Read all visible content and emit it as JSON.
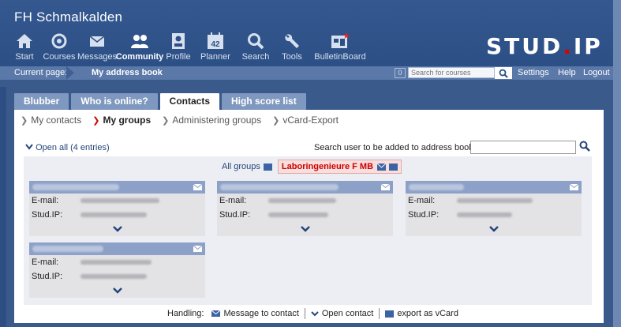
{
  "site": {
    "name": "FH Schmalkalden"
  },
  "brand": {
    "prefix": "STUD",
    "dot": ".",
    "suffix": "IP"
  },
  "nav": [
    {
      "label": "Start",
      "icon": "home-icon"
    },
    {
      "label": "Courses",
      "icon": "seminar-icon"
    },
    {
      "label": "Messages",
      "icon": "mail-icon"
    },
    {
      "label": "Community",
      "icon": "community-icon"
    },
    {
      "label": "Profile",
      "icon": "profile-icon"
    },
    {
      "label": "Planner",
      "icon": "calendar-icon"
    },
    {
      "label": "Search",
      "icon": "search-icon"
    },
    {
      "label": "Tools",
      "icon": "wrench-icon"
    },
    {
      "label": "BulletinBoard",
      "icon": "board-icon"
    }
  ],
  "planner_day": "42",
  "breadcrumb": {
    "prefix": "Current page:",
    "page": "My address book"
  },
  "quicksearch": {
    "count": "0",
    "placeholder": "Search for courses"
  },
  "toplinks": {
    "settings": "Settings",
    "help": "Help",
    "logout": "Logout"
  },
  "tabs": [
    "Blubber",
    "Who is online?",
    "Contacts",
    "High score list"
  ],
  "subnav": [
    "My contacts",
    "My groups",
    "Administering groups",
    "vCard-Export"
  ],
  "openall": "Open all (4 entries)",
  "search_user_label": "Search user to be added to address book:",
  "group_tabs": {
    "all": "All groups",
    "selected": "Laboringenieure F MB"
  },
  "field_labels": {
    "email": "E-mail:",
    "studip": "Stud.IP:"
  },
  "handling": {
    "label": "Handling:",
    "message": "Message to contact",
    "open": "Open contact",
    "vcard": "export as vCard"
  }
}
